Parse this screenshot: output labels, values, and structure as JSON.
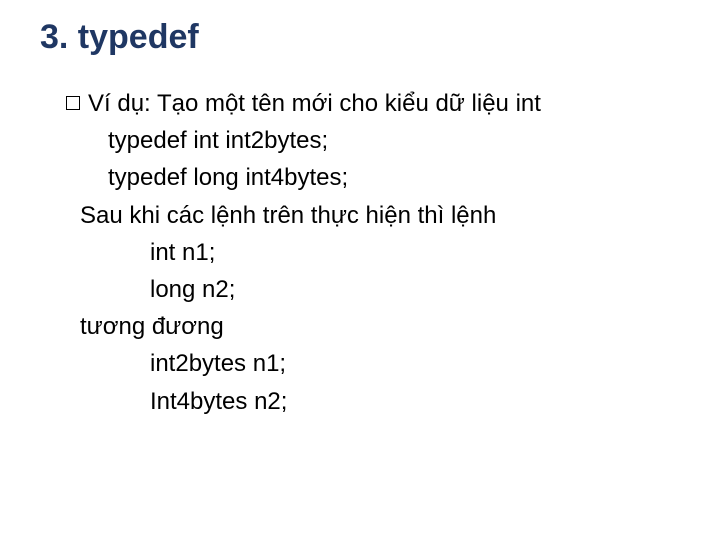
{
  "title": "3. typedef",
  "bullet_label": "Ví dụ: Tạo một tên mới cho kiểu dữ liệu int",
  "lines": {
    "l1": "typedef int int2bytes;",
    "l2": "typedef long int4bytes;",
    "l3": "Sau khi các lệnh trên thực hiện thì lệnh",
    "l4": "int n1;",
    "l5": "long n2;",
    "l6": "tương đương",
    "l7": "int2bytes n1;",
    "l8": "Int4bytes  n2;"
  }
}
